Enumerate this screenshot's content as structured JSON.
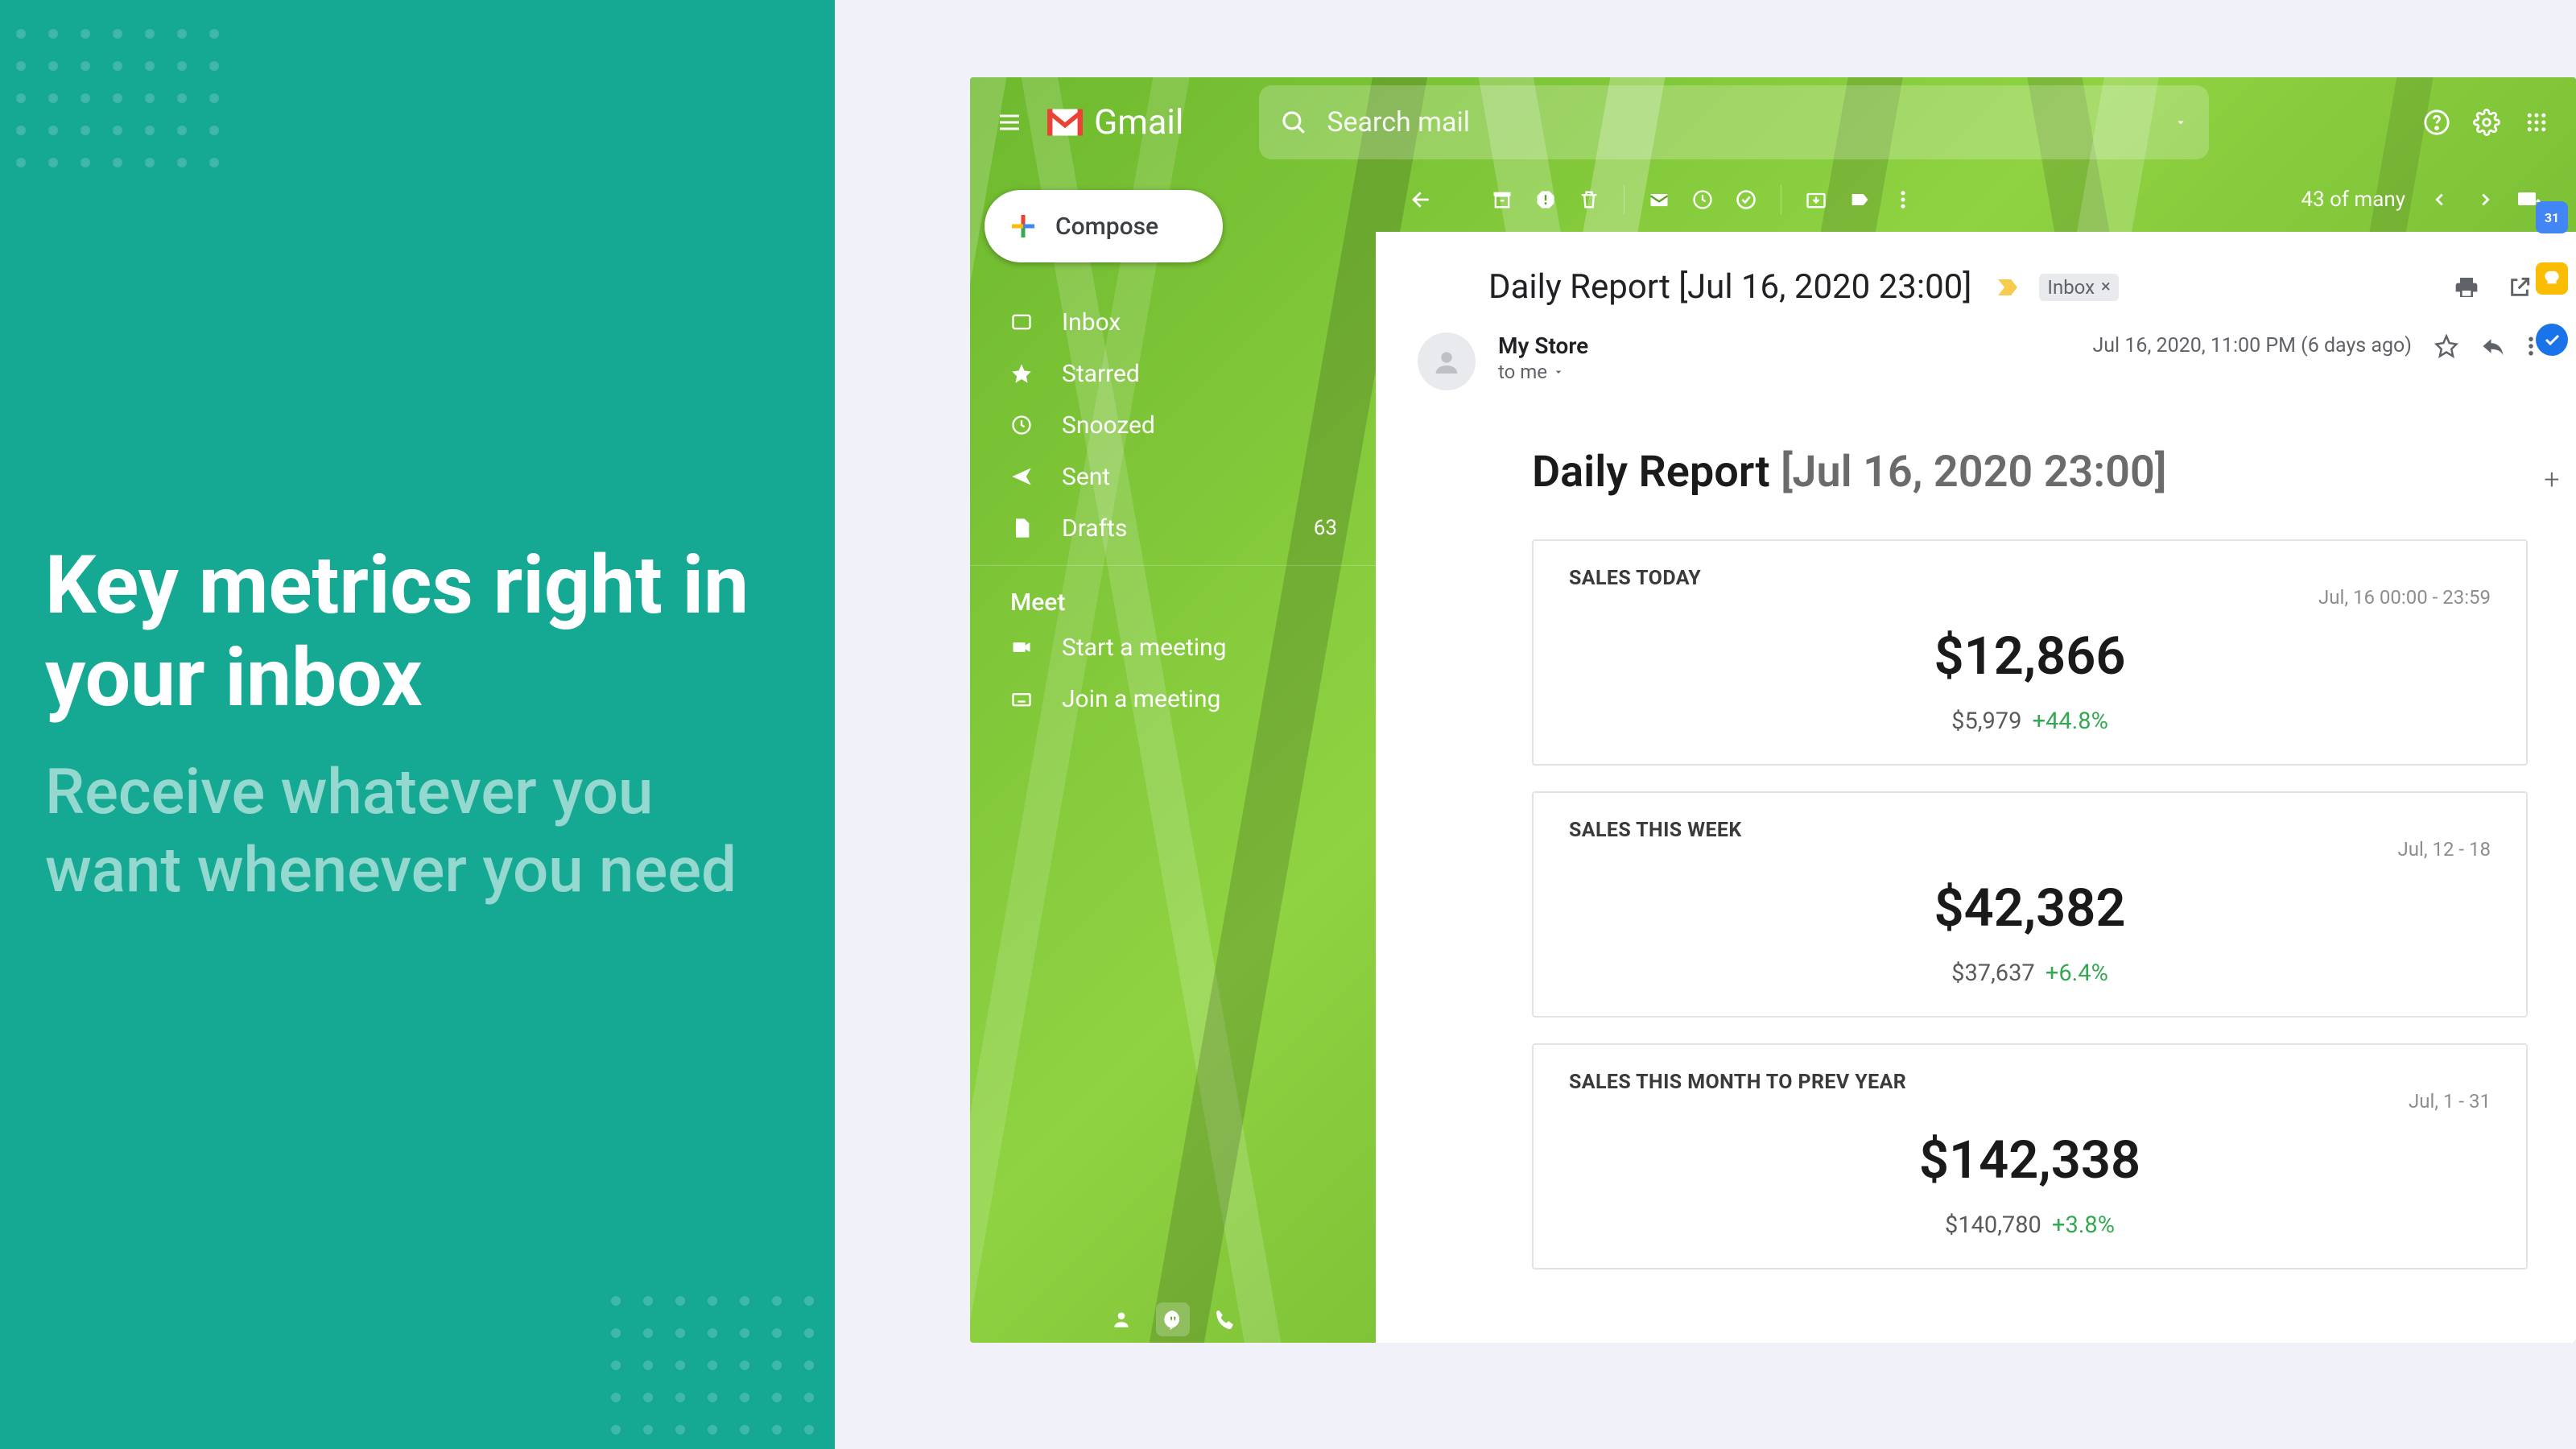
{
  "promo": {
    "title": "Key metrics right in your inbox",
    "subtitle": "Receive whatever you want whenever you need"
  },
  "gmail": {
    "brand": "Gmail",
    "search_placeholder": "Search mail",
    "compose": "Compose",
    "nav": {
      "inbox": "Inbox",
      "starred": "Starred",
      "snoozed": "Snoozed",
      "sent": "Sent",
      "drafts": "Drafts",
      "drafts_count": "63"
    },
    "meet_section": "Meet",
    "meet": {
      "start": "Start a meeting",
      "join": "Join a meeting"
    },
    "page_info": "43 of many",
    "rail_calendar": "31"
  },
  "email": {
    "subject": "Daily Report [Jul 16, 2020 23:00]",
    "label_chip": "Inbox",
    "sender": "My Store",
    "to": "to me",
    "sent_time": "Jul 16, 2020, 11:00 PM (6 days ago)",
    "report_title_prefix": "Daily Report ",
    "report_title_bracket": "[Jul 16, 2020 23:00]",
    "cards": [
      {
        "title": "SALES TODAY",
        "range": "Jul, 16 00:00 - 23:59",
        "value": "$12,866",
        "prev": "$5,979",
        "delta": "+44.8%"
      },
      {
        "title": "SALES THIS WEEK",
        "range": "Jul, 12 - 18",
        "value": "$42,382",
        "prev": "$37,637",
        "delta": "+6.4%"
      },
      {
        "title": "SALES THIS MONTH TO PREV YEAR",
        "range": "Jul, 1 - 31",
        "value": "$142,338",
        "prev": "$140,780",
        "delta": "+3.8%"
      }
    ]
  }
}
